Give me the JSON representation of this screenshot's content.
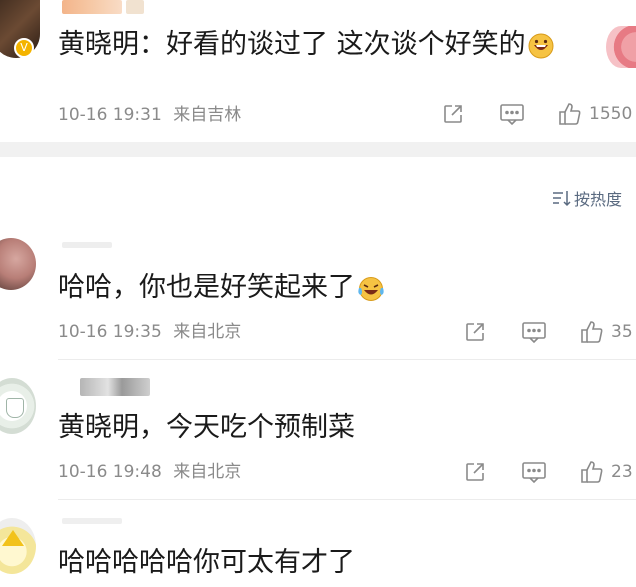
{
  "sort_label": "按热度",
  "comments": [
    {
      "text": "黄晓明：好看的谈过了 这次谈个好笑的",
      "time": "10-16 19:31",
      "location": "来自吉林",
      "likes": "1550",
      "emoji": "grinning-emoji",
      "verified": true
    },
    {
      "text": "哈哈，你也是好笑起来了",
      "time": "10-16 19:35",
      "location": "来自北京",
      "likes": "35",
      "emoji": "laughing-tears-emoji"
    },
    {
      "text": "黄晓明，今天吃个预制菜",
      "time": "10-16 19:48",
      "location": "来自北京",
      "likes": "23"
    },
    {
      "text": "哈哈哈哈哈你可太有才了"
    }
  ],
  "icons": {
    "share": "share-icon",
    "comment": "comment-icon",
    "like": "thumbs-up-icon",
    "sort": "sort-icon"
  }
}
